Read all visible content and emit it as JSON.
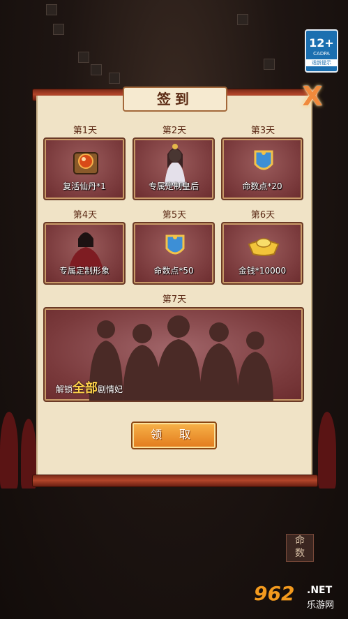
{
  "badge": {
    "age": "12+",
    "org": "CADPA",
    "tip": "适龄提示"
  },
  "dialog": {
    "title": "签到",
    "close_label": "X"
  },
  "days": [
    {
      "day": "第1天",
      "reward": "复活仙丹*1"
    },
    {
      "day": "第2天",
      "reward": "专属定制皇后"
    },
    {
      "day": "第3天",
      "reward": "命数点*20"
    },
    {
      "day": "第4天",
      "reward": "专属定制形象"
    },
    {
      "day": "第5天",
      "reward": "命数点*50"
    },
    {
      "day": "第6天",
      "reward": "金钱*10000"
    }
  ],
  "day7": {
    "day": "第7天",
    "caption_prefix": "解锁",
    "caption_highlight": "全部",
    "caption_suffix": "剧情妃"
  },
  "claim_button": "领 取",
  "corner_icon": {
    "top": "命",
    "bottom": "数"
  },
  "watermark": {
    "number": "962",
    "site": ".NET",
    "cn": "乐游网"
  },
  "colors": {
    "accent": "#f08a3c",
    "card": "#7a3a3c",
    "panel": "#f0e3c6"
  }
}
